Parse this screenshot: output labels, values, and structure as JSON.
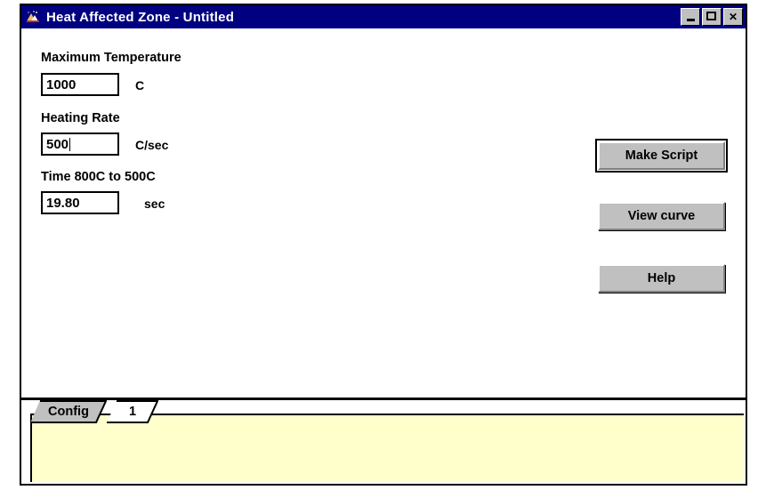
{
  "window": {
    "title": "Heat Affected Zone - Untitled",
    "icon": "app-icon",
    "colors": {
      "titlebar": "#000080",
      "titlebar_text": "#ffffff",
      "panel": "#ffffff",
      "button_face": "#c0c0c0",
      "tab_page": "#ffffcc",
      "border": "#000000"
    },
    "controls": [
      {
        "name": "minimize",
        "glyph": "_"
      },
      {
        "name": "maximize",
        "glyph": "□"
      },
      {
        "name": "close",
        "glyph": "✕"
      }
    ]
  },
  "form": {
    "fields": [
      {
        "label": "Maximum Temperature",
        "value": "1000",
        "unit": "C",
        "focused": false
      },
      {
        "label": "Heating Rate",
        "value": "500",
        "unit": "C/sec",
        "focused": true
      },
      {
        "label": "Time 800C to 500C",
        "value": "19.80",
        "unit": "sec",
        "focused": false
      }
    ]
  },
  "actions": {
    "make_script": "Make Script",
    "view_curve": "View curve",
    "help": "Help"
  },
  "tabs": {
    "items": [
      {
        "label": "Config",
        "selected": true
      },
      {
        "label": "1",
        "selected": false
      }
    ]
  }
}
